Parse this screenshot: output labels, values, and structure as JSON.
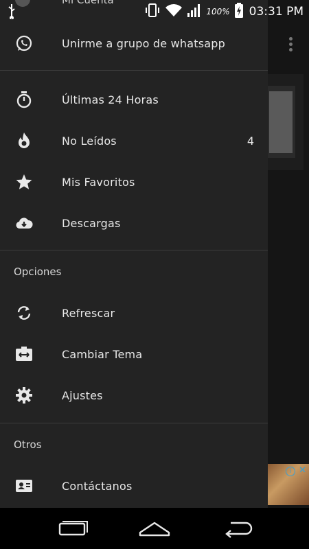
{
  "status_bar": {
    "battery_percent": "100%",
    "time": "03:31 PM"
  },
  "drawer": {
    "account_title": "Mi Cuenta",
    "whatsapp_label": "Unirme a grupo de whatsapp",
    "items": [
      {
        "label": "Últimas 24 Horas",
        "icon": "timer-icon"
      },
      {
        "label": "No Leídos",
        "icon": "flame-icon",
        "count": "4"
      },
      {
        "label": "Mis Favoritos",
        "icon": "star-icon"
      },
      {
        "label": "Descargas",
        "icon": "cloud-download-icon"
      }
    ],
    "options_header": "Opciones",
    "options": [
      {
        "label": "Refrescar",
        "icon": "refresh-icon"
      },
      {
        "label": "Cambiar Tema",
        "icon": "swap-theme-icon"
      },
      {
        "label": "Ajustes",
        "icon": "gear-icon"
      }
    ],
    "others_header": "Otros",
    "others": [
      {
        "label": "Contáctanos",
        "icon": "contact-card-icon"
      }
    ]
  },
  "colors": {
    "drawer_bg": "#232323",
    "divider": "#3d3d3d",
    "text": "#e8e8e8",
    "ad_info": "#3aa0d6"
  }
}
